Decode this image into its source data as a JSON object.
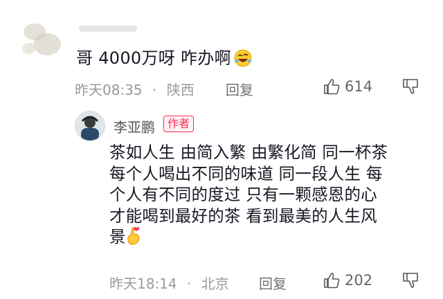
{
  "comment1": {
    "text": "哥 4000万呀 咋办啊",
    "emoji": "rofl-emoji",
    "time": "昨天08:35",
    "location": "陕西",
    "reply_label": "回复",
    "likes": "614"
  },
  "comment2": {
    "username": "李亚鹏",
    "author_badge": "作者",
    "lines": [
      "茶如人生 由简入繁 由繁化简 同一杯茶",
      "每个人喝出不同的味道 同一段人生 每",
      "个人有不同的度过 只有一颗感恩的心",
      "才能喝到最好的茶 看到最美的人生风",
      "景"
    ],
    "emoji": "finger-heart-emoji",
    "time": "昨天18:14",
    "location": "北京",
    "reply_label": "回复",
    "likes": "202"
  },
  "separator": "·",
  "colors": {
    "author_badge": "#fe2c55",
    "meta_gray": "#9a9a9a"
  }
}
